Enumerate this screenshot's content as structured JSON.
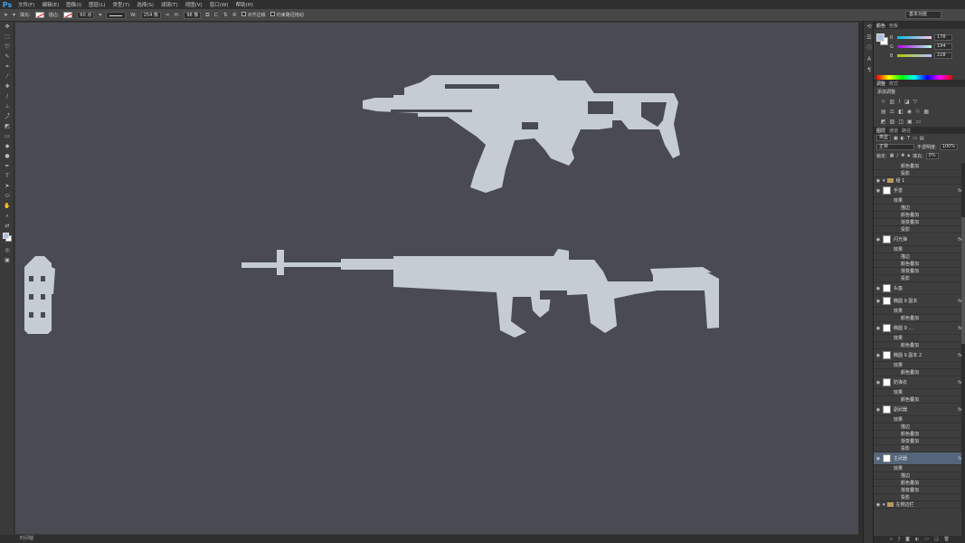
{
  "app": {
    "logo": "Ps"
  },
  "menu": [
    "文件(F)",
    "编辑(E)",
    "图像(I)",
    "图层(L)",
    "类型(Y)",
    "选择(S)",
    "滤镜(T)",
    "视图(V)",
    "窗口(W)",
    "帮助(H)"
  ],
  "options": {
    "fill_label": "填充:",
    "stroke_label": "描边:",
    "stroke_size": "60 点",
    "w_label": "W:",
    "w_value": "254 像",
    "h_label": "H:",
    "h_value": "98 像",
    "align_edges": "对齐边缘",
    "constrain_path": "约束路径拖动",
    "workspace": "基本功能"
  },
  "statusbar": {
    "text": "时间轴"
  },
  "color_panel": {
    "tabs": [
      "颜色",
      "色板"
    ],
    "r_label": "R",
    "r_value": "178",
    "g_label": "G",
    "g_value": "194",
    "b_label": "B",
    "b_value": "228",
    "fg_color": "#aebfe0"
  },
  "adjust_panel": {
    "tabs": [
      "调整",
      "样式"
    ],
    "title": "添加调整"
  },
  "layers_panel": {
    "tabs": [
      "图层",
      "通道",
      "路径"
    ],
    "filter_label": "类型",
    "blend_mode": "正常",
    "opacity_label": "不透明度:",
    "opacity_value": "100%",
    "lock_label": "锁定:",
    "fill_label": "填充:",
    "fill_value": "0%",
    "rows": [
      {
        "text": "颜色叠加",
        "kind": "effect"
      },
      {
        "text": "投影",
        "kind": "effect"
      },
      {
        "text": "组 1",
        "kind": "group"
      },
      {
        "text": "手雷",
        "kind": "layer",
        "fx": "fx"
      },
      {
        "text": "效果",
        "kind": "effects"
      },
      {
        "text": "描边",
        "kind": "effect"
      },
      {
        "text": "颜色叠加",
        "kind": "effect"
      },
      {
        "text": "渐变叠加",
        "kind": "effect"
      },
      {
        "text": "投影",
        "kind": "effect"
      },
      {
        "text": "闪光弹",
        "kind": "layer",
        "fx": "fx"
      },
      {
        "text": "效果",
        "kind": "effects"
      },
      {
        "text": "描边",
        "kind": "effect"
      },
      {
        "text": "颜色叠加",
        "kind": "effect"
      },
      {
        "text": "渐变叠加",
        "kind": "effect"
      },
      {
        "text": "投影",
        "kind": "effect"
      },
      {
        "text": "头盔",
        "kind": "layer"
      },
      {
        "text": "椭圆 9 副本",
        "kind": "layer",
        "fx": "fx"
      },
      {
        "text": "效果",
        "kind": "effects"
      },
      {
        "text": "颜色叠加",
        "kind": "effect"
      },
      {
        "text": "椭圆 9 ...",
        "kind": "layer",
        "fx": "fx"
      },
      {
        "text": "效果",
        "kind": "effects"
      },
      {
        "text": "颜色叠加",
        "kind": "effect"
      },
      {
        "text": "椭圆 9 副本 2",
        "kind": "layer",
        "fx": "fx"
      },
      {
        "text": "效果",
        "kind": "effects"
      },
      {
        "text": "颜色叠加",
        "kind": "effect"
      },
      {
        "text": "防弹衣",
        "kind": "layer",
        "fx": "fx"
      },
      {
        "text": "效果",
        "kind": "effects"
      },
      {
        "text": "颜色叠加",
        "kind": "effect"
      },
      {
        "text": "副武器",
        "kind": "layer",
        "fx": "fx"
      },
      {
        "text": "效果",
        "kind": "effects"
      },
      {
        "text": "描边",
        "kind": "effect"
      },
      {
        "text": "颜色叠加",
        "kind": "effect"
      },
      {
        "text": "渐变叠加",
        "kind": "effect"
      },
      {
        "text": "投影",
        "kind": "effect"
      },
      {
        "text": "主武器",
        "kind": "layer",
        "fx": "fx",
        "selected": true
      },
      {
        "text": "效果",
        "kind": "effects"
      },
      {
        "text": "描边",
        "kind": "effect"
      },
      {
        "text": "颜色叠加",
        "kind": "effect"
      },
      {
        "text": "渐变叠加",
        "kind": "effect"
      },
      {
        "text": "投影",
        "kind": "effect"
      },
      {
        "text": "左侧边栏",
        "kind": "group"
      }
    ]
  },
  "canvas": {
    "background": "#4a4b52",
    "shape_color": "#c5ccd4"
  }
}
